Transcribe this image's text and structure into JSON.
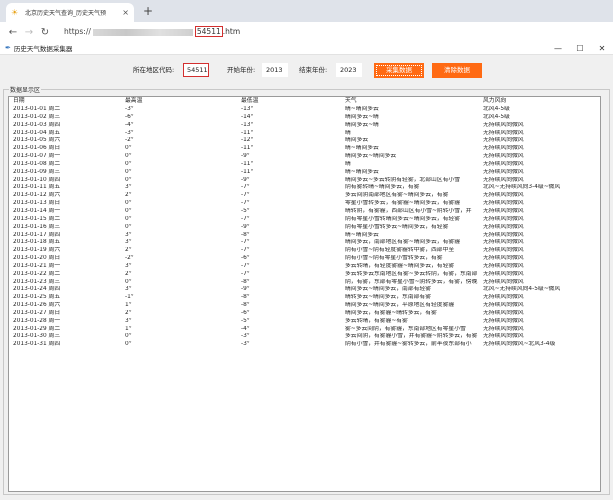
{
  "browser": {
    "tab_title": "北京历史天气查询_历史天气预",
    "url_prefix": "https://",
    "url_code": "54511",
    "url_suffix": ".htm"
  },
  "app": {
    "title": "历史天气数据采集器",
    "region_label": "所在地区代码:",
    "region_value": "54511",
    "start_label": "开始年份:",
    "start_value": "2013",
    "end_label": "结束年份:",
    "end_value": "2023",
    "collect_button": "采集数据",
    "clear_button": "清除数据",
    "group_title": "数据显示区"
  },
  "table": {
    "headers": [
      "日期",
      "最高温",
      "最低温",
      "天气",
      "风力风向"
    ],
    "rows": [
      [
        "2013-01-01 周二",
        "-3°",
        "-13°",
        "晴~晴间多云",
        "北风4-5级"
      ],
      [
        "2013-01-02 周三",
        "-6°",
        "-14°",
        "晴间多云~晴",
        "北风4-5级"
      ],
      [
        "2013-01-03 周四",
        "-4°",
        "-13°",
        "晴间多云~晴",
        "无持续风向微风"
      ],
      [
        "2013-01-04 周五",
        "-3°",
        "-11°",
        "晴",
        "无持续风向微风"
      ],
      [
        "2013-01-05 周六",
        "-2°",
        "-12°",
        "晴间多云",
        "无持续风向微风"
      ],
      [
        "2013-01-06 周日",
        "0°",
        "-11°",
        "晴~晴间多云",
        "无持续风向微风"
      ],
      [
        "2013-01-07 周一",
        "0°",
        "-9°",
        "晴间多云~晴间多云",
        "无持续风向微风"
      ],
      [
        "2013-01-08 周二",
        "0°",
        "-11°",
        "晴",
        "无持续风向微风"
      ],
      [
        "2013-01-09 周三",
        "0°",
        "-11°",
        "晴~晴间多云",
        "无持续风向微风"
      ],
      [
        "2013-01-10 周四",
        "0°",
        "-9°",
        "晴间多云~多云转阴有轻雾，北部山区有小雪",
        "无持续风向微风"
      ],
      [
        "2013-01-11 周五",
        "3°",
        "-7°",
        "阴有雾转晴~晴间多云，有雾",
        "北风~无持续风向3-4级~微风"
      ],
      [
        "2013-01-12 周六",
        "2°",
        "-7°",
        "多云间阴南部地区有雾~晴间多云，有雾",
        "无持续风向微风"
      ],
      [
        "2013-01-13 周日",
        "0°",
        "-7°",
        "零星小雪转多云，有雾霾~晴间多云，有雾霾",
        "无持续风向微风"
      ],
      [
        "2013-01-14 周一",
        "0°",
        "-5°",
        "晴转阴，有雾霾，西部山区有小雪~阴转小雪，并",
        "无持续风向微风"
      ],
      [
        "2013-01-15 周二",
        "0°",
        "-7°",
        "阴有零星小雪转晴间多云~晴间多云，有轻雾",
        "无持续风向微风"
      ],
      [
        "2013-01-16 周三",
        "0°",
        "-9°",
        "阴有零星小雪转多云~晴间多云，有轻雾",
        "无持续风向微风"
      ],
      [
        "2013-01-17 周四",
        "3°",
        "-8°",
        "晴~晴间多云",
        "无持续风向微风"
      ],
      [
        "2013-01-18 周五",
        "3°",
        "-7°",
        "晴间多云，南部地区有雾~晴间多云，有雾霾",
        "无持续风向微风"
      ],
      [
        "2013-01-19 周六",
        "2°",
        "-7°",
        "阴有小雪~阴有轻度雾霾转中雾，西部中至",
        "无持续风向微风"
      ],
      [
        "2013-01-20 周日",
        "-2°",
        "-6°",
        "阴有小雪~阴有零星小雪转多云，有雾",
        "无持续风向微风"
      ],
      [
        "2013-01-21 周一",
        "3°",
        "-7°",
        "多云转晴，有轻度雾霾~晴间多云，有轻雾",
        "无持续风向微风"
      ],
      [
        "2013-01-22 周二",
        "2°",
        "-7°",
        "多云转多云东南地区有雾~多云转阴，有雾，东南部",
        "无持续风向微风"
      ],
      [
        "2013-01-23 周三",
        "0°",
        "-8°",
        "阴，有雾，东部有零星小雪~阴转多云，有雾，傍晚",
        "无持续风向微风"
      ],
      [
        "2013-01-24 周四",
        "3°",
        "-9°",
        "晴间多云~晴间多云，南部有轻雾",
        "北风~无持续风向4-5级~微风"
      ],
      [
        "2013-01-25 周五",
        "-1°",
        "-8°",
        "晴转多云~晴间多云，东南部有雾",
        "无持续风向微风"
      ],
      [
        "2013-01-26 周六",
        "1°",
        "-8°",
        "晴间多云~晴间多云，平原地区有轻度雾霾",
        "无持续风向微风"
      ],
      [
        "2013-01-27 周日",
        "2°",
        "-6°",
        "晴间多云，有雾霾~晴转多云，有雾",
        "无持续风向微风"
      ],
      [
        "2013-01-28 周一",
        "3°",
        "-5°",
        "多云转晴，有雾霾~有雾",
        "无持续风向微风"
      ],
      [
        "2013-01-29 周二",
        "1°",
        "-4°",
        "雾~多云间阴，有雾霾，东南部地区有零星小雪",
        "无持续风向微风"
      ],
      [
        "2013-01-30 周三",
        "0°",
        "-3°",
        "多云间阴，有雾霾小雪，并有雾霾~阴转多云，有雾",
        "无持续风向微风"
      ],
      [
        "2013-01-31 周四",
        "0°",
        "-3°",
        "阴有小雪，并有雾霾~雾转多云，前半夜东部有小",
        "无持续风向微风~北风3-4级"
      ]
    ]
  }
}
